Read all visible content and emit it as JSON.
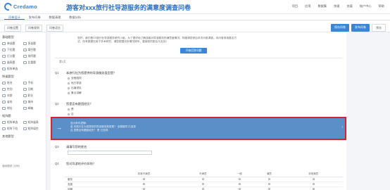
{
  "app": {
    "logo_text": "Credamo",
    "survey_title": "游客对xxx旅行社导游服务的满意度调查问卷"
  },
  "topnav": [
    "项目",
    "应用",
    "数据集",
    "快速",
    "充值",
    "账户中心",
    "帮助"
  ],
  "tabs": [
    "问卷设计",
    "发布问卷",
    "数据清理",
    "数据分析"
  ],
  "toolbar": {
    "left": [
      "问卷设置",
      "问卷规则",
      "问卷语言"
    ],
    "save": "保存问卷",
    "publish": "发布问卷",
    "preview": "预览"
  },
  "sidebar": {
    "basic_title": "基础题型",
    "basic": [
      "单选题",
      "多选题",
      "下拉题",
      "填空题",
      "打分题",
      "排序题",
      "量表题",
      "比重题",
      "矩阵单选"
    ],
    "quick_title": "快速题型",
    "quick": [
      "姓名",
      "手机",
      "性别",
      "日期",
      "年龄",
      "职业",
      "省份",
      "城市",
      "地址",
      "邮箱"
    ],
    "matrix_title": "矩阵题",
    "matrix": [
      "矩阵单选",
      "矩阵量表",
      "矩阵下拉",
      "矩阵填空"
    ],
    "other_title": "其他题型",
    "footer": "通用题型 (示例)"
  },
  "canvas": {
    "intro": "您好，我们是XX旅行社导游服务研究小组，为了更好地了解游客对导游服务的满意度情况，特邀请您参加本次问卷调查。本问卷采用匿名方式，所有数据仅用于学术研究，请您根据实际情况填写，感谢您的配合与支持！",
    "start_button": "开始回答问题",
    "page_label": "第1页",
    "q1": {
      "num": "Q1",
      "text": "本旅行社为您提供的导游服务类型是？",
      "options": [
        "全程陪同",
        "地方导游",
        "出境领队",
        "景点讲解"
      ]
    },
    "q2": {
      "num": "Q2",
      "text": "您是否有跟团经历？",
      "options": [
        "是",
        "否"
      ]
    },
    "logic": {
      "header": "显示条件逻辑：",
      "line1": "若 本旅行社为您提供的导游服务类型是？ 全程陪同 已选择",
      "line2": "且 您是否有跟团经历？ 是 已选择"
    },
    "q3": {
      "num": "Q3",
      "text": "请填写您的姓名"
    },
    "q4": {
      "num": "Q4",
      "text": "您对导游的评价如何？",
      "columns": [
        "",
        "非常不满意",
        "不满意",
        "一般",
        "满意",
        "非常满意"
      ],
      "rows": [
        "服务",
        "态度",
        "讲解"
      ]
    }
  }
}
